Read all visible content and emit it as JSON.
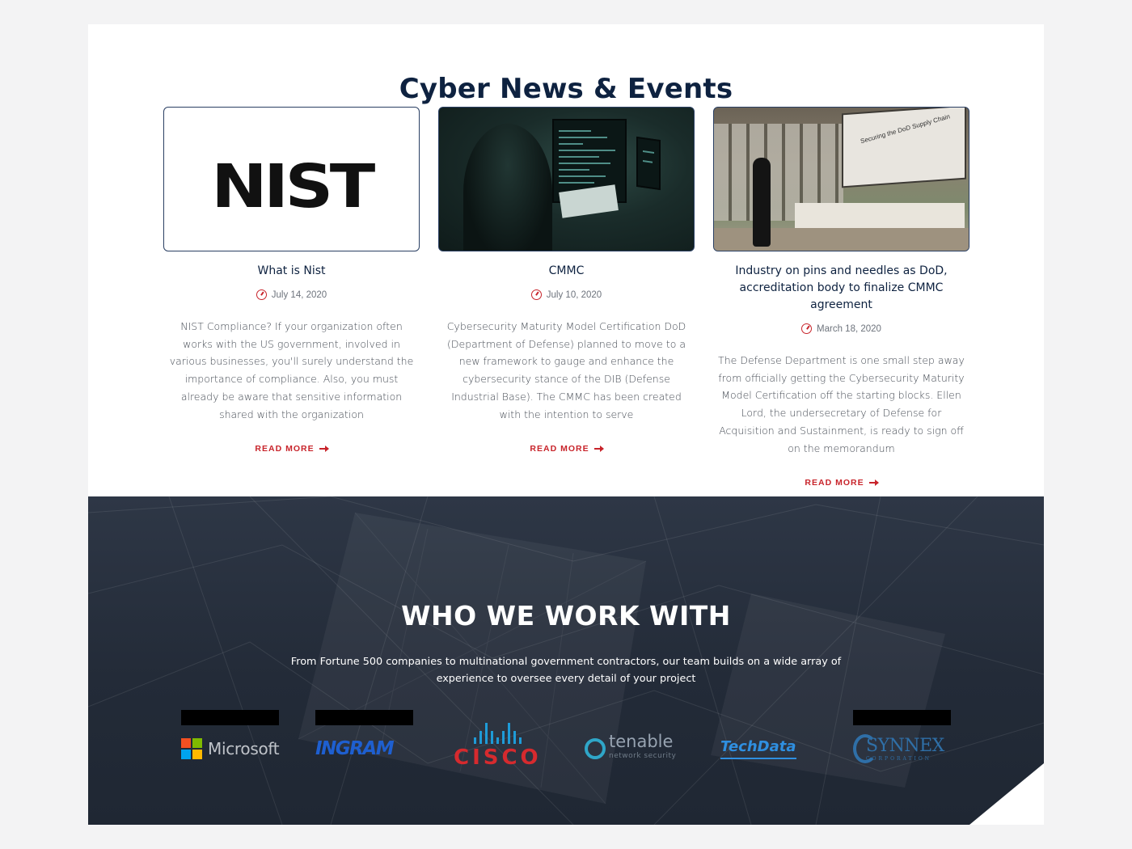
{
  "news": {
    "title": "Cyber News & Events",
    "cards": [
      {
        "title": "What is Nist",
        "date": "July 14, 2020",
        "logo_text": "NIST",
        "excerpt": "NIST Compliance? If your organization often works with the US government, involved in various businesses, you'll surely understand the importance of compliance. Also, you must already be aware that sensitive information shared with the organization",
        "read_more": "READ MORE"
      },
      {
        "title": "CMMC",
        "date": "July 10, 2020",
        "excerpt": "Cybersecurity Maturity Model Certification DoD (Department of Defense) planned to move to a new framework to gauge and enhance the cybersecurity stance of the DIB (Defense Industrial Base). The CMMC has been created with the intention to serve",
        "read_more": "READ MORE"
      },
      {
        "title": "Industry on pins and needles as DoD, accreditation body to finalize CMMC agreement",
        "date": "March 18, 2020",
        "screen_text": "Securing the DoD Supply Chain",
        "excerpt": "The Defense Department is one small step away from officially getting the Cybersecurity Maturity Model Certification off the starting blocks. Ellen Lord, the undersecretary of Defense for Acquisition and Sustainment, is ready to sign off on the memorandum",
        "read_more": "READ MORE"
      }
    ]
  },
  "work": {
    "title": "WHO WE WORK WITH",
    "description": "From Fortune 500 companies to multinational government contractors, our team builds on a wide array of experience to oversee every detail of your project",
    "partners": {
      "microsoft": "Microsoft",
      "ingram": "INGRAM",
      "cisco": "CISCO",
      "tenable": "tenable",
      "tenable_sub": "network security",
      "techdata": "TechData",
      "synnex": "SYNNEX",
      "synnex_sub": "CORPORATION"
    }
  },
  "colors": {
    "navy": "#0e2240",
    "accent_red": "#c8242b",
    "dark_section": "#232b38"
  }
}
